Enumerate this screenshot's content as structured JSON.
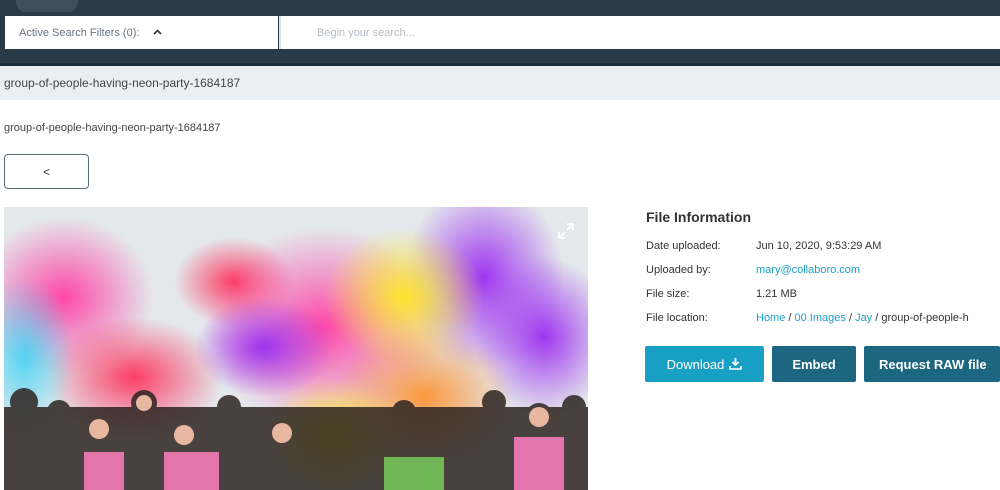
{
  "search": {
    "filter_label": "Active Search Filters (0):",
    "placeholder": "Begin your search..."
  },
  "page": {
    "title": "group-of-people-having-neon-party-1684187",
    "subtitle": "group-of-people-having-neon-party-1684187",
    "back_label": "<"
  },
  "file_info": {
    "heading": "File Information",
    "date_label": "Date uploaded:",
    "date_value": "Jun 10, 2020, 9:53:29 AM",
    "uploader_label": "Uploaded by:",
    "uploader_value": "mary@collaboro.com",
    "size_label": "File size:",
    "size_value": "1.21 MB",
    "location_label": "File location:",
    "location_home": "Home",
    "location_sep1": " / ",
    "location_folder": "00 Images",
    "location_sep2": " / ",
    "location_sub": "Jay",
    "location_rest": " / group-of-people-h"
  },
  "actions": {
    "download_label": "Download",
    "embed_label": "Embed",
    "raw_label": "Request RAW file"
  },
  "colors": {
    "header_bg": "#2b3a47",
    "accent": "#17a0c4",
    "button_dark": "#1d6680",
    "link": "#1ba0c8"
  },
  "icons": {
    "filter_toggle": "chevron-up-icon",
    "download": "download-icon",
    "expand": "expand-icon"
  }
}
